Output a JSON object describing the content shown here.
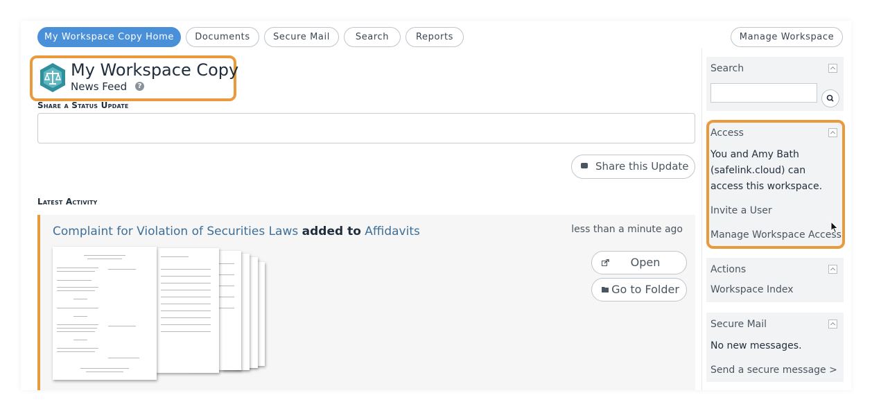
{
  "nav": {
    "home": "My Workspace Copy Home",
    "documents": "Documents",
    "secure_mail": "Secure Mail",
    "search": "Search",
    "reports": "Reports",
    "manage": "Manage Workspace"
  },
  "header": {
    "title": "My Workspace Copy",
    "subtitle": "News Feed",
    "help": "?"
  },
  "status": {
    "label": "Share a Status Update",
    "placeholder": "",
    "share_button": "Share this Update"
  },
  "activity": {
    "label": "Latest Activity",
    "item": {
      "document": "Complaint for Violation of Securities Laws",
      "verb": "added to",
      "folder": "Affidavits",
      "time": "less than a minute ago",
      "open_button": "Open",
      "folder_button": "Go to Folder"
    }
  },
  "sidebar": {
    "search": {
      "heading": "Search"
    },
    "access": {
      "heading": "Access",
      "text": "You and Amy Bath (safelink.cloud) can access this workspace.",
      "invite": "Invite a User",
      "manage": "Manage Workspace Access"
    },
    "actions": {
      "heading": "Actions",
      "index": "Workspace Index"
    },
    "secure_mail": {
      "heading": "Secure Mail",
      "status": "No new messages.",
      "send": "Send a secure message >"
    }
  },
  "colors": {
    "accent": "#e99a3c",
    "primary": "#4a90d9",
    "link": "#3e6f98",
    "logo": "#2f8f9d"
  }
}
